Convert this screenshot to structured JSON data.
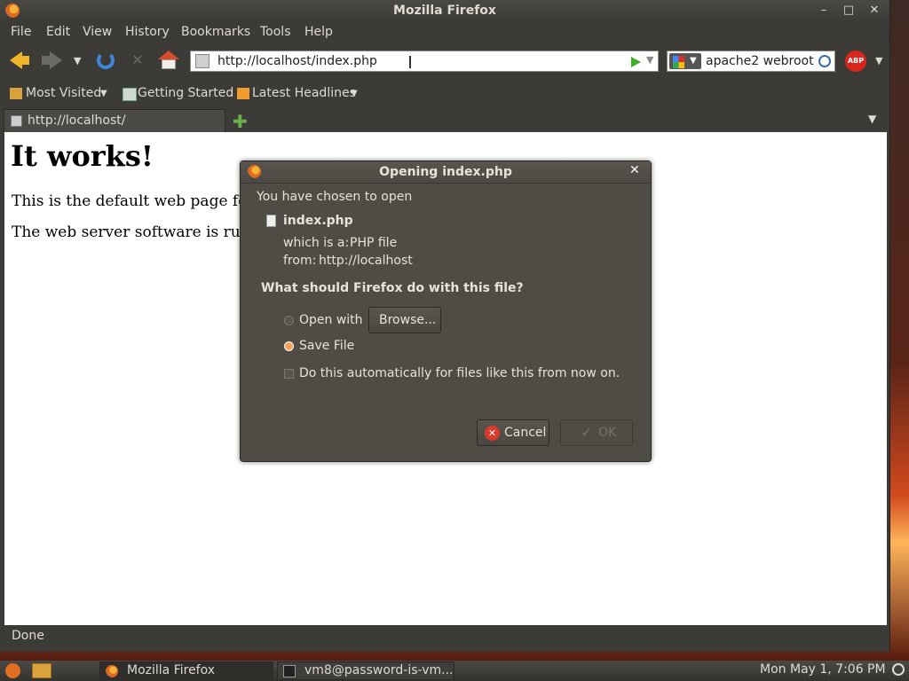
{
  "window": {
    "title": "Mozilla Firefox"
  },
  "menu": [
    "File",
    "Edit",
    "View",
    "History",
    "Bookmarks",
    "Tools",
    "Help"
  ],
  "navigation": {
    "url": "http://localhost/index.php",
    "search_engine": "google",
    "search_text": "apache2 webroot",
    "addon_label": "ABP"
  },
  "bookmarks": [
    {
      "label": "Most Visited",
      "icon": "folder-star-icon"
    },
    {
      "label": "Getting Started",
      "icon": "page-icon"
    },
    {
      "label": "Latest Headlines",
      "icon": "rss-icon"
    }
  ],
  "tabs": [
    {
      "label": "http://localhost/"
    }
  ],
  "page": {
    "heading": "It works!",
    "paragraph1": "This is the default web page for",
    "paragraph2": "The web server software is runn"
  },
  "status": "Done",
  "dialog": {
    "title": "Opening index.php",
    "intro": "You have chosen to open",
    "filename": "index.php",
    "type_label": "which is a:",
    "type_value": "PHP file",
    "from_label": "from:",
    "from_value": "http://localhost",
    "question": "What should Firefox do with this file?",
    "open_with_label": "Open with",
    "browse_label": "Browse...",
    "save_file_label": "Save File",
    "auto_label": "Do this automatically for files like this from now on.",
    "cancel_label": "Cancel",
    "ok_label": "OK",
    "selected_option": "save_file",
    "auto_checked": false
  },
  "taskbar": {
    "items": [
      "Mozilla Firefox",
      "vm8@password-is-vm..."
    ],
    "clock": "Mon May  1,  7:06 PM"
  },
  "colors": {
    "accent": "#e99a57",
    "panel": "#3c3b37",
    "dialog": "#4f4b45"
  }
}
